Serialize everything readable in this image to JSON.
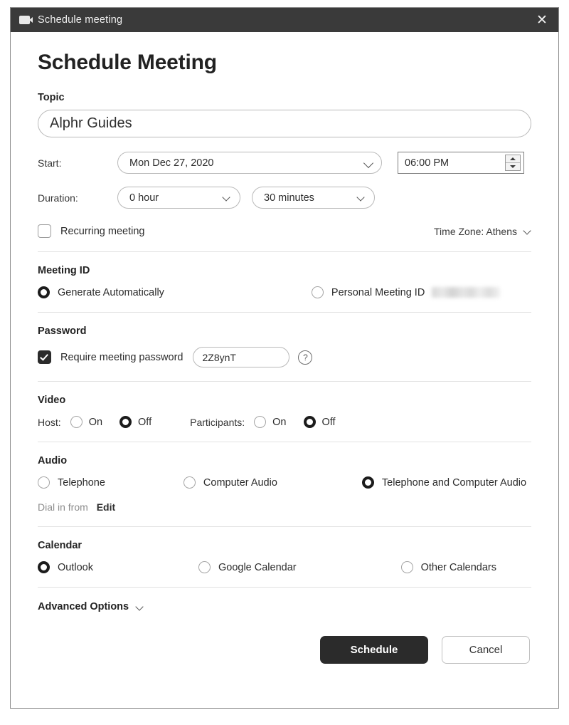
{
  "titlebar": {
    "title": "Schedule meeting",
    "close_label": "✕",
    "icon": "video-camera-icon"
  },
  "page_title": "Schedule Meeting",
  "topic": {
    "label": "Topic",
    "value": "Alphr Guides",
    "placeholder": "Topic"
  },
  "start": {
    "label": "Start:",
    "date_value": "Mon Dec 27, 2020",
    "time_value": "06:00 PM"
  },
  "duration": {
    "label": "Duration:",
    "hours_value": "0 hour",
    "minutes_value": "30 minutes"
  },
  "recurring": {
    "label": "Recurring meeting",
    "checked": false
  },
  "timezone": {
    "label": "Time Zone: Athens"
  },
  "meeting_id": {
    "title": "Meeting ID",
    "options": [
      {
        "label": "Generate Automatically",
        "selected": true
      },
      {
        "label": "Personal Meeting ID",
        "selected": false,
        "redacted_value": true
      }
    ]
  },
  "password": {
    "title": "Password",
    "require_label": "Require meeting password",
    "checked": true,
    "value": "2Z8ynT",
    "help_glyph": "?"
  },
  "video": {
    "title": "Video",
    "groups": [
      {
        "label": "Host:",
        "options": [
          {
            "label": "On",
            "selected": false
          },
          {
            "label": "Off",
            "selected": true
          }
        ]
      },
      {
        "label": "Participants:",
        "options": [
          {
            "label": "On",
            "selected": false
          },
          {
            "label": "Off",
            "selected": true
          }
        ]
      }
    ]
  },
  "audio": {
    "title": "Audio",
    "options": [
      {
        "label": "Telephone",
        "selected": false
      },
      {
        "label": "Computer Audio",
        "selected": false
      },
      {
        "label": "Telephone and Computer Audio",
        "selected": true
      }
    ],
    "dial_in_label": "Dial in from",
    "edit_label": "Edit"
  },
  "calendar": {
    "title": "Calendar",
    "options": [
      {
        "label": "Outlook",
        "selected": true
      },
      {
        "label": "Google Calendar",
        "selected": false
      },
      {
        "label": "Other Calendars",
        "selected": false
      }
    ]
  },
  "advanced_options": {
    "label": "Advanced Options"
  },
  "footer": {
    "schedule_label": "Schedule",
    "cancel_label": "Cancel"
  },
  "colors": {
    "titlebar_bg": "#3a3a3a",
    "primary_button_bg": "#2b2b2b",
    "text": "#2b2b2b",
    "border": "#b9b9b9"
  }
}
